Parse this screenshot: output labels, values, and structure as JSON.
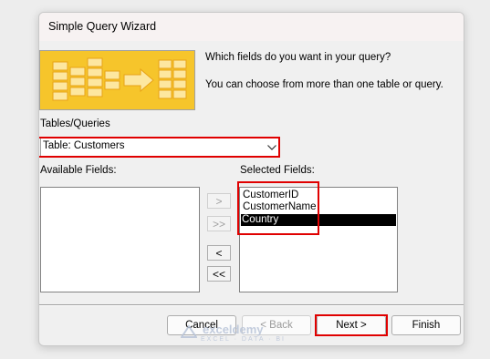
{
  "window": {
    "title": "Simple Query Wizard"
  },
  "intro": {
    "question": "Which fields do you want in your query?",
    "hint": "You can choose from more than one table or query."
  },
  "tables_queries": {
    "label": "Tables/Queries",
    "selected": "Table: Customers"
  },
  "available_fields": {
    "label": "Available Fields:",
    "items": []
  },
  "selected_fields": {
    "label": "Selected Fields:",
    "items": [
      "CustomerID",
      "CustomerName",
      "Country"
    ],
    "selected_item": "Country"
  },
  "move_buttons": {
    "add_one": ">",
    "add_all": ">>",
    "remove_one": "<",
    "remove_all": "<<"
  },
  "buttons": {
    "cancel": "Cancel",
    "back": "< Back",
    "next": "Next >",
    "finish": "Finish"
  },
  "watermark": {
    "name": "exceldemy",
    "tagline": "EXCEL · DATA · BI"
  },
  "colors": {
    "banner": "#f6c52b",
    "highlight": "#e00000",
    "selection": "#000000"
  }
}
